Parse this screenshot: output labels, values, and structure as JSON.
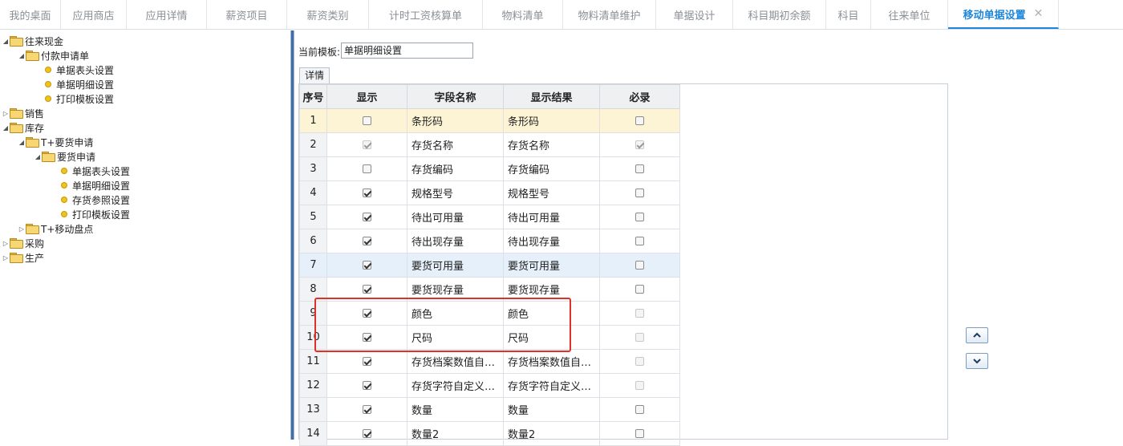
{
  "tabs": [
    {
      "label": "我的桌面",
      "active": false
    },
    {
      "label": "应用商店",
      "active": false
    },
    {
      "label": "应用详情",
      "active": false
    },
    {
      "label": "薪资项目",
      "active": false
    },
    {
      "label": "薪资类别",
      "active": false
    },
    {
      "label": "计时工资核算单",
      "active": false
    },
    {
      "label": "物料清单",
      "active": false
    },
    {
      "label": "物料清单维护",
      "active": false
    },
    {
      "label": "单据设计",
      "active": false
    },
    {
      "label": "科目期初余额",
      "active": false
    },
    {
      "label": "科目",
      "active": false
    },
    {
      "label": "往来单位",
      "active": false
    },
    {
      "label": "移动单据设置",
      "active": true
    }
  ],
  "tree": [
    {
      "label": "往来现金",
      "type": "folder",
      "level": 0,
      "expanded": true
    },
    {
      "label": "付款申请单",
      "type": "folder",
      "level": 1,
      "expanded": true
    },
    {
      "label": "单据表头设置",
      "type": "leaf",
      "level": 2
    },
    {
      "label": "单据明细设置",
      "type": "leaf",
      "level": 2
    },
    {
      "label": "打印模板设置",
      "type": "leaf",
      "level": 2
    },
    {
      "label": "销售",
      "type": "folder",
      "level": 0,
      "expanded": false
    },
    {
      "label": "库存",
      "type": "folder",
      "level": 0,
      "expanded": true
    },
    {
      "label": "T+要货申请",
      "type": "folder",
      "level": 1,
      "expanded": true
    },
    {
      "label": "要货申请",
      "type": "folder",
      "level": 2,
      "expanded": true
    },
    {
      "label": "单据表头设置",
      "type": "leaf",
      "level": 3
    },
    {
      "label": "单据明细设置",
      "type": "leaf",
      "level": 3
    },
    {
      "label": "存货参照设置",
      "type": "leaf",
      "level": 3
    },
    {
      "label": "打印模板设置",
      "type": "leaf",
      "level": 3
    },
    {
      "label": "T+移动盘点",
      "type": "folder",
      "level": 1,
      "expanded": false
    },
    {
      "label": "采购",
      "type": "folder",
      "level": 0,
      "expanded": false
    },
    {
      "label": "生产",
      "type": "folder",
      "level": 0,
      "expanded": false
    }
  ],
  "template": {
    "label": "当前模板:",
    "value": "单据明细设置"
  },
  "subtab": "详情",
  "table": {
    "headers": [
      "序号",
      "显示",
      "字段名称",
      "显示结果",
      "必录"
    ],
    "rows": [
      {
        "no": "1",
        "show": false,
        "show_disabled": false,
        "name": "条形码",
        "result": "条形码",
        "req": false,
        "req_disabled": false
      },
      {
        "no": "2",
        "show": true,
        "show_disabled": true,
        "name": "存货名称",
        "result": "存货名称",
        "req": true,
        "req_disabled": true
      },
      {
        "no": "3",
        "show": false,
        "show_disabled": false,
        "name": "存货编码",
        "result": "存货编码",
        "req": false,
        "req_disabled": false
      },
      {
        "no": "4",
        "show": true,
        "show_disabled": false,
        "name": "规格型号",
        "result": "规格型号",
        "req": false,
        "req_disabled": false
      },
      {
        "no": "5",
        "show": true,
        "show_disabled": false,
        "name": "待出可用量",
        "result": "待出可用量",
        "req": false,
        "req_disabled": false
      },
      {
        "no": "6",
        "show": true,
        "show_disabled": false,
        "name": "待出现存量",
        "result": "待出现存量",
        "req": false,
        "req_disabled": false
      },
      {
        "no": "7",
        "show": true,
        "show_disabled": false,
        "name": "要货可用量",
        "result": "要货可用量",
        "req": false,
        "req_disabled": false
      },
      {
        "no": "8",
        "show": true,
        "show_disabled": false,
        "name": "要货现存量",
        "result": "要货现存量",
        "req": false,
        "req_disabled": false
      },
      {
        "no": "9",
        "show": true,
        "show_disabled": false,
        "name": "颜色",
        "result": "颜色",
        "req": false,
        "req_disabled": true
      },
      {
        "no": "10",
        "show": true,
        "show_disabled": false,
        "name": "尺码",
        "result": "尺码",
        "req": false,
        "req_disabled": true
      },
      {
        "no": "11",
        "show": true,
        "show_disabled": false,
        "name": "存货档案数值自…",
        "result": "存货档案数值自…",
        "req": false,
        "req_disabled": true
      },
      {
        "no": "12",
        "show": true,
        "show_disabled": false,
        "name": "存货字符自定义…",
        "result": "存货字符自定义…",
        "req": false,
        "req_disabled": true
      },
      {
        "no": "13",
        "show": true,
        "show_disabled": false,
        "name": "数量",
        "result": "数量",
        "req": false,
        "req_disabled": false
      },
      {
        "no": "14",
        "show": true,
        "show_disabled": false,
        "name": "数量2",
        "result": "数量2",
        "req": false,
        "req_disabled": false
      }
    ],
    "highlight_yellow_row": 0,
    "highlight_blue_row": 6
  },
  "icons": {
    "tab_close": "close-icon",
    "move_up": "chevron-up-icon",
    "move_down": "chevron-down-icon"
  },
  "colors": {
    "accent": "#1f86d8",
    "annotation": "#e0302a",
    "row_selected": "#fdf4d5",
    "row_hover": "#e6f0fb"
  }
}
